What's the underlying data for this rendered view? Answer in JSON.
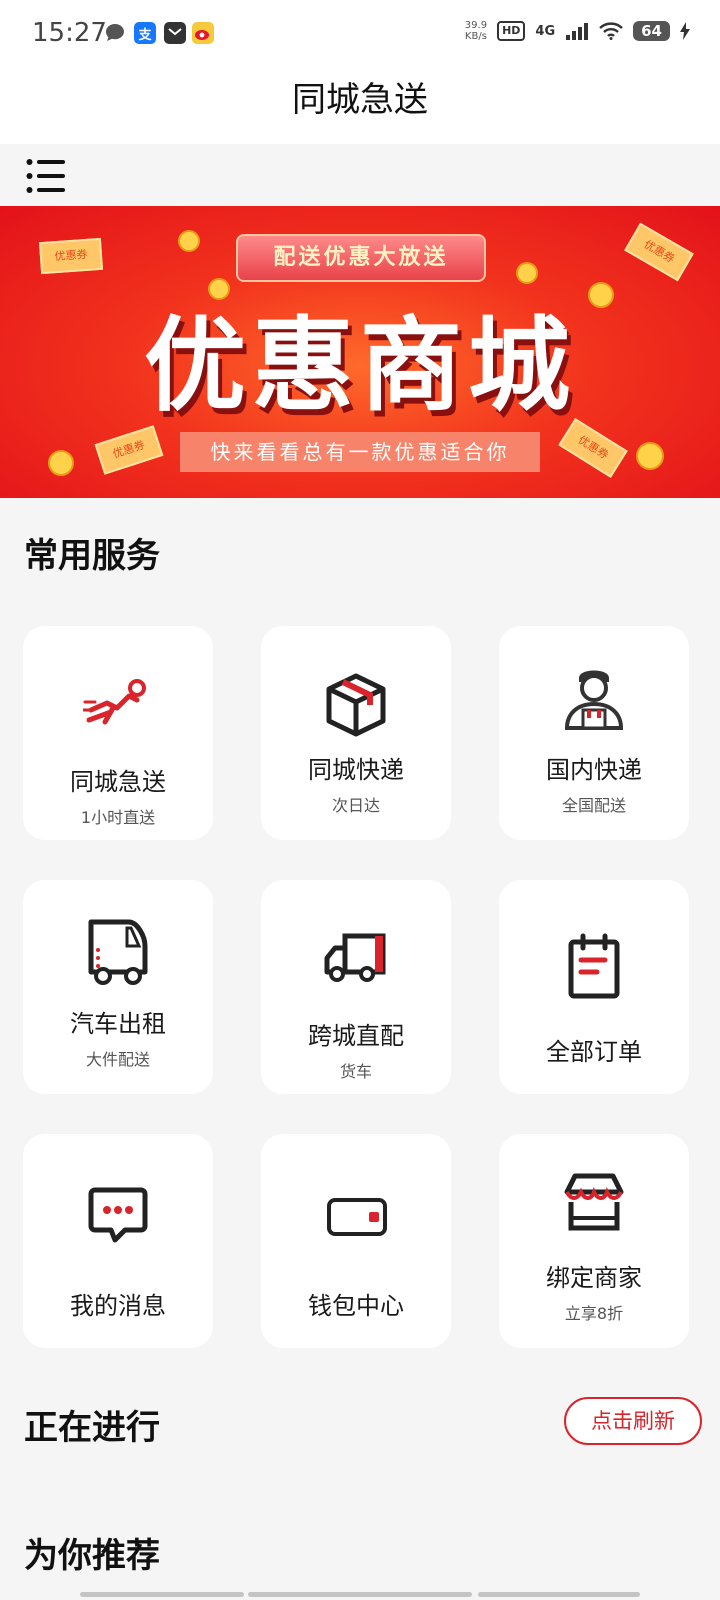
{
  "status": {
    "time": "15:27",
    "net_speed_value": "39.9",
    "net_speed_unit": "KB/s",
    "hd": "HD",
    "network": "4G",
    "battery": "64"
  },
  "header": {
    "title": "同城急送"
  },
  "banner": {
    "tag": "配送优惠大放送",
    "headline": "优惠商城",
    "subline": "快来看看总有一款优惠适合你",
    "coupon_text": "优惠券"
  },
  "services": {
    "section_title": "常用服务",
    "items": [
      {
        "label": "同城急送",
        "sub": "1小时直送",
        "icon": "runner-icon"
      },
      {
        "label": "同城快递",
        "sub": "次日达",
        "icon": "package-box-icon"
      },
      {
        "label": "国内快递",
        "sub": "全国配送",
        "icon": "courier-icon"
      },
      {
        "label": "汽车出租",
        "sub": "大件配送",
        "icon": "van-icon"
      },
      {
        "label": "跨城直配",
        "sub": "货车",
        "icon": "truck-icon"
      },
      {
        "label": "全部订单",
        "sub": "",
        "icon": "clipboard-icon"
      },
      {
        "label": "我的消息",
        "sub": "",
        "icon": "message-icon"
      },
      {
        "label": "钱包中心",
        "sub": "",
        "icon": "wallet-icon"
      },
      {
        "label": "绑定商家",
        "sub": "立享8折",
        "icon": "shop-icon"
      }
    ]
  },
  "ongoing": {
    "section_title": "正在进行",
    "refresh_label": "点击刷新"
  },
  "recommend": {
    "section_title": "为你推荐"
  },
  "colors": {
    "accent": "#d8242a",
    "banner_red": "#e3121a",
    "page_bg": "#f5f5f5"
  }
}
